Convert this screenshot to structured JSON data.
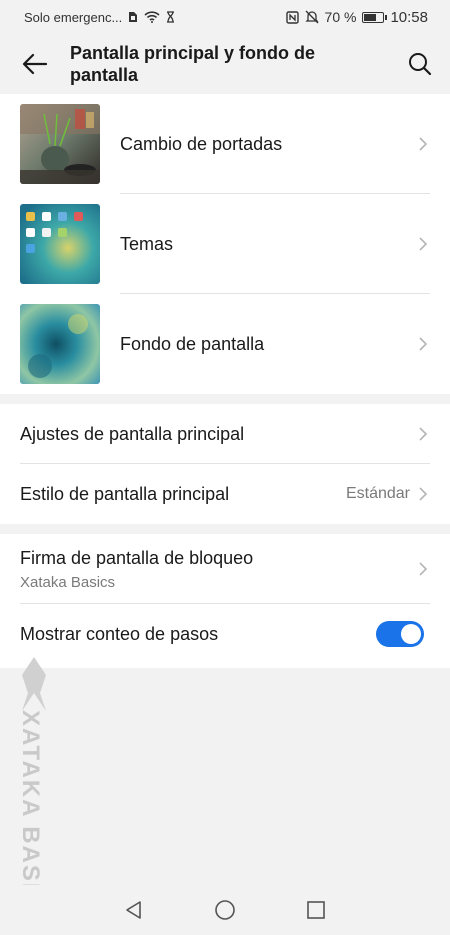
{
  "status_bar": {
    "carrier": "Solo emergenc...",
    "battery_percent": "70 %",
    "battery_level": 0.7,
    "clock": "10:58"
  },
  "app_bar": {
    "title": "Pantalla principal y fondo de pantalla"
  },
  "image_items": [
    {
      "label": "Cambio de portadas",
      "icon": "cover-change-thumbnail"
    },
    {
      "label": "Temas",
      "icon": "themes-thumbnail"
    },
    {
      "label": "Fondo de pantalla",
      "icon": "wallpaper-thumbnail"
    }
  ],
  "settings": {
    "home_settings": "Ajustes de pantalla principal",
    "home_style": "Estilo de pantalla principal",
    "home_style_value": "Estándar",
    "lock_signature": "Firma de pantalla de bloqueo",
    "lock_signature_value": "Xataka Basics",
    "step_count": "Mostrar conteo de pasos",
    "step_count_enabled": true
  },
  "watermark": "XATAKA BASICS",
  "colors": {
    "accent": "#1a73e8",
    "background": "#f2f2f2"
  }
}
